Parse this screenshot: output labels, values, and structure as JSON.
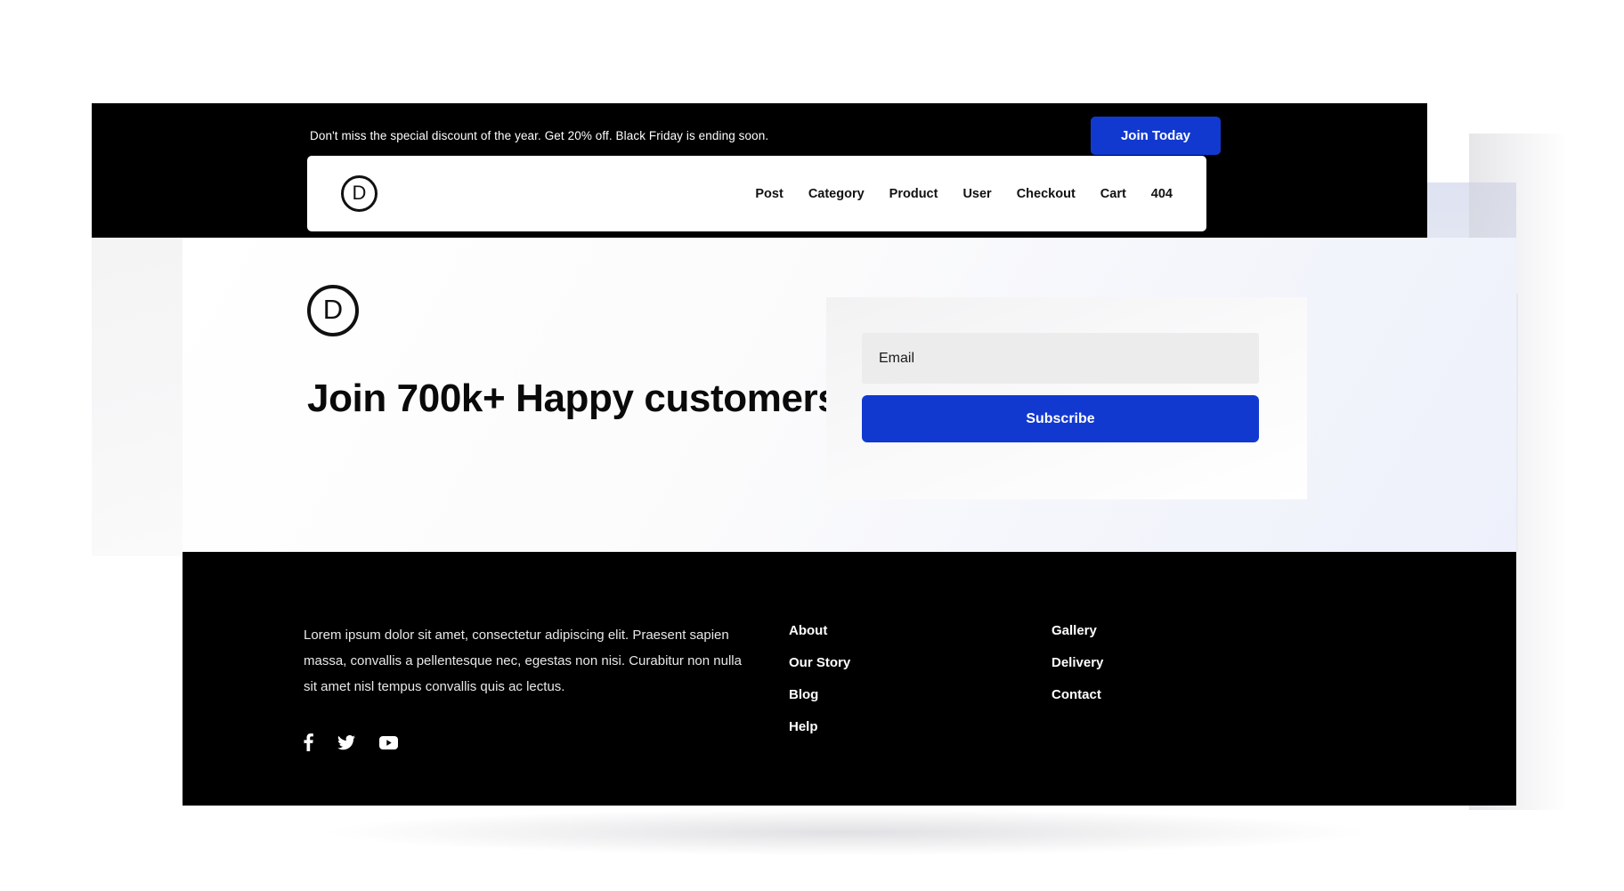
{
  "announcement": {
    "text": "Don't miss the special discount of the year. Get 20% off. Black Friday is ending soon.",
    "cta_label": "Join Today"
  },
  "navbar": {
    "logo_letter": "D",
    "links": [
      {
        "label": "Post"
      },
      {
        "label": "Category"
      },
      {
        "label": "Product"
      },
      {
        "label": "User"
      },
      {
        "label": "Checkout"
      },
      {
        "label": "Cart"
      },
      {
        "label": "404"
      }
    ]
  },
  "hero": {
    "logo_letter": "D",
    "title": "Join 700k+ Happy customers",
    "subscribe": {
      "email_placeholder": "Email",
      "email_value": "",
      "button_label": "Subscribe"
    }
  },
  "footer": {
    "description": "Lorem ipsum dolor sit amet, consectetur adipiscing elit. Praesent sapien massa, convallis a pellentesque nec, egestas non nisi. Curabitur non nulla sit amet nisl tempus convallis quis ac lectus.",
    "social": [
      {
        "name": "facebook-icon"
      },
      {
        "name": "twitter-icon"
      },
      {
        "name": "youtube-icon"
      }
    ],
    "columns": [
      {
        "links": [
          {
            "label": "About"
          },
          {
            "label": "Our Story"
          },
          {
            "label": "Blog"
          },
          {
            "label": "Help"
          }
        ]
      },
      {
        "links": [
          {
            "label": "Gallery"
          },
          {
            "label": "Delivery"
          },
          {
            "label": "Contact"
          }
        ]
      }
    ]
  },
  "colors": {
    "accent_blue": "#1239cf",
    "dark": "#000000",
    "input_bg": "#ececec",
    "lavender": "#dfe3f1"
  }
}
